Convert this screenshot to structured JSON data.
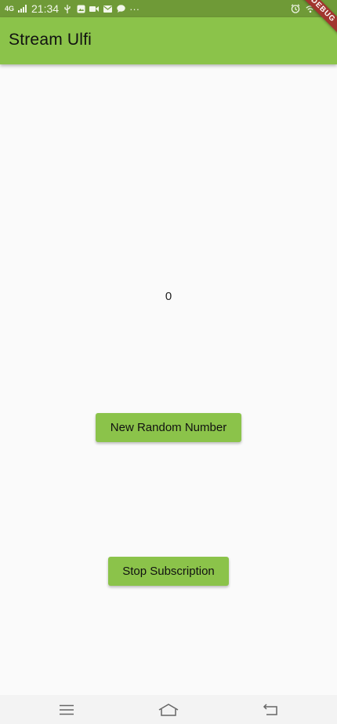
{
  "status_bar": {
    "network": "4G",
    "time": "21:34",
    "more": "···"
  },
  "app_bar": {
    "title": "Stream Ulfi",
    "debug_banner": "DEBUG"
  },
  "main": {
    "counter_value": "0",
    "new_random_button": "New Random Number",
    "stop_subscription_button": "Stop Subscription"
  },
  "colors": {
    "primary": "#8bc34a",
    "status_bar": "#6f9a37",
    "debug_banner": "#a1362f",
    "background": "#fafafa"
  },
  "icons": {
    "status_left": [
      "usb-icon",
      "gallery-icon",
      "video-icon",
      "mail-icon",
      "chat-icon"
    ],
    "status_right": [
      "alarm-icon",
      "wifi-icon"
    ],
    "nav": [
      "menu-icon",
      "home-icon",
      "back-icon"
    ]
  }
}
